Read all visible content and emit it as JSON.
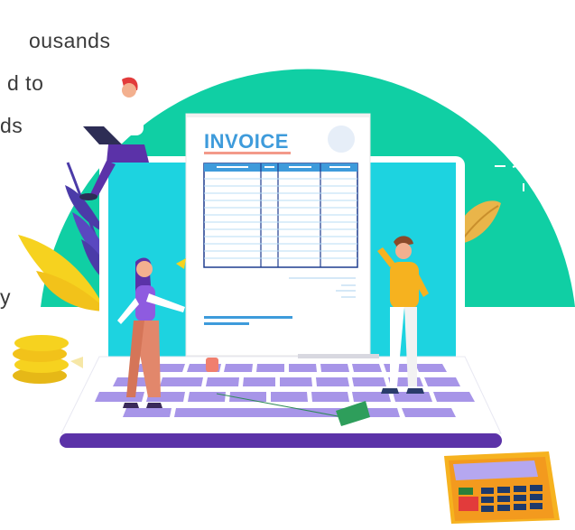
{
  "partial_text": {
    "line1": "ousands",
    "line2": "d to",
    "line3": "ds",
    "line4": "y"
  },
  "invoice": {
    "title": "INVOICE"
  },
  "colors": {
    "teal": "#10CFA4",
    "cyan": "#1DD3E0",
    "purple": "#6C4AB6",
    "lavender": "#A795E8",
    "invoice_title": "#3E9BDB",
    "table_blue": "#1F6FCF",
    "yellow": "#F6D21F",
    "orange": "#F39A1E"
  }
}
